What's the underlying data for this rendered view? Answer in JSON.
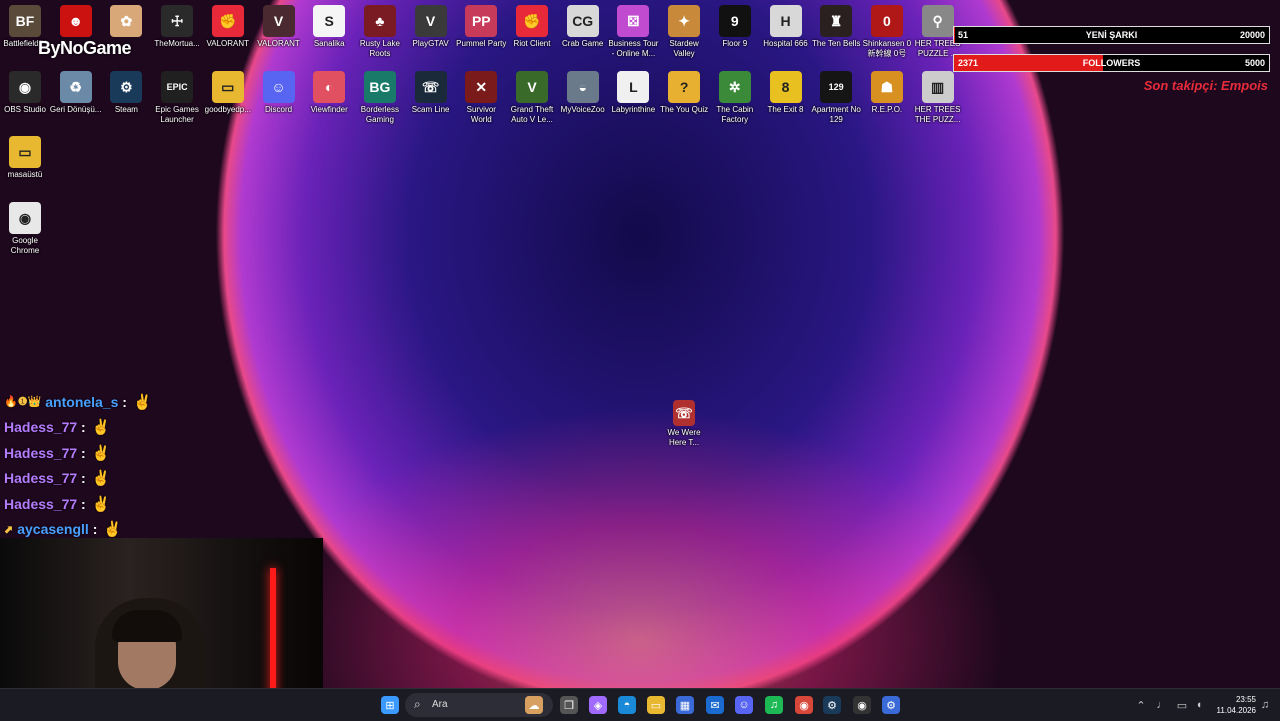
{
  "desktop_icons": [
    {
      "label": "Battlefield™",
      "color": "#5a4a3a",
      "glyph": "BF",
      "col": 0,
      "row": 0
    },
    {
      "label": "",
      "color": "#cc1111",
      "glyph": "☻",
      "col": 1,
      "row": 0
    },
    {
      "label": "",
      "color": "#d9a878",
      "glyph": "✿",
      "col": 2,
      "row": 0
    },
    {
      "label": "TheMortua...",
      "color": "#2a2a2a",
      "glyph": "☩",
      "col": 3,
      "row": 0
    },
    {
      "label": "VALORANT",
      "color": "#e8293a",
      "glyph": "✊",
      "col": 4,
      "row": 0
    },
    {
      "label": "VALORANT",
      "color": "#4a2a30",
      "glyph": "V",
      "col": 5,
      "row": 0
    },
    {
      "label": "Sanalika",
      "color": "#f5f5f5",
      "glyph": "S",
      "col": 6,
      "row": 0
    },
    {
      "label": "Rusty Lake Roots",
      "color": "#7a1a22",
      "glyph": "♣",
      "col": 7,
      "row": 0
    },
    {
      "label": "PlayGTAV",
      "color": "#3a3a3a",
      "glyph": "V",
      "col": 8,
      "row": 0
    },
    {
      "label": "Pummel Party",
      "color": "#c83a5a",
      "glyph": "PP",
      "col": 9,
      "row": 0
    },
    {
      "label": "Riot Client",
      "color": "#e8293a",
      "glyph": "✊",
      "col": 10,
      "row": 0
    },
    {
      "label": "Crab Game",
      "color": "#d8d8d8",
      "glyph": "CG",
      "col": 11,
      "row": 0
    },
    {
      "label": "Business Tour - Online M...",
      "color": "#c04ad0",
      "glyph": "⚄",
      "col": 12,
      "row": 0
    },
    {
      "label": "Stardew Valley",
      "color": "#c88a3a",
      "glyph": "✦",
      "col": 13,
      "row": 0
    },
    {
      "label": "Floor 9",
      "color": "#111111",
      "glyph": "9",
      "col": 14,
      "row": 0
    },
    {
      "label": "Hospital 666",
      "color": "#d8d8d8",
      "glyph": "H",
      "col": 15,
      "row": 0
    },
    {
      "label": "The Ten Bells",
      "color": "#2a2020",
      "glyph": "♜",
      "col": 16,
      "row": 0
    },
    {
      "label": "Shinkansen 0 新幹線 0号",
      "color": "#b01818",
      "glyph": "0",
      "col": 17,
      "row": 0
    },
    {
      "label": "HER TREES PUZZLE ...",
      "color": "#888888",
      "glyph": "⚲",
      "col": 18,
      "row": 0
    },
    {
      "label": "OBS Studio",
      "color": "#2a2a2a",
      "glyph": "◉",
      "col": 0,
      "row": 1
    },
    {
      "label": "Geri Dönüşü...",
      "color": "#6a8aa8",
      "glyph": "♻",
      "col": 1,
      "row": 1
    },
    {
      "label": "Steam",
      "color": "#1a3a5a",
      "glyph": "⚙",
      "col": 2,
      "row": 1
    },
    {
      "label": "Epic Games Launcher",
      "color": "#202020",
      "glyph": "EPIC",
      "col": 3,
      "row": 1
    },
    {
      "label": "goodbyedp...",
      "color": "#e8b830",
      "glyph": "▭",
      "col": 4,
      "row": 1
    },
    {
      "label": "Discord",
      "color": "#5865f2",
      "glyph": "☺",
      "col": 5,
      "row": 1
    },
    {
      "label": "Viewfinder",
      "color": "#e05060",
      "glyph": "◐",
      "col": 6,
      "row": 1
    },
    {
      "label": "Borderless Gaming",
      "color": "#1a7a6a",
      "glyph": "BG",
      "col": 7,
      "row": 1
    },
    {
      "label": "Scam Line",
      "color": "#1a2a3a",
      "glyph": "☏",
      "col": 8,
      "row": 1
    },
    {
      "label": "Survivor World",
      "color": "#7a1a1a",
      "glyph": "✕",
      "col": 9,
      "row": 1
    },
    {
      "label": "Grand Theft Auto V Le...",
      "color": "#3a6a2a",
      "glyph": "V",
      "col": 10,
      "row": 1
    },
    {
      "label": "MyVoiceZoo",
      "color": "#6a7a8a",
      "glyph": "◒",
      "col": 11,
      "row": 1
    },
    {
      "label": "Labyrinthine",
      "color": "#f0f0f0",
      "glyph": "L",
      "col": 12,
      "row": 1
    },
    {
      "label": "The You Quiz",
      "color": "#e8b030",
      "glyph": "?",
      "col": 13,
      "row": 1
    },
    {
      "label": "The Cabin Factory",
      "color": "#3a8a3a",
      "glyph": "✲",
      "col": 14,
      "row": 1
    },
    {
      "label": "The Exit 8",
      "color": "#e8c020",
      "glyph": "8",
      "col": 15,
      "row": 1
    },
    {
      "label": "Apartment No 129",
      "color": "#151515",
      "glyph": "129",
      "col": 16,
      "row": 1
    },
    {
      "label": "R.E.P.O.",
      "color": "#d89020",
      "glyph": "☗",
      "col": 17,
      "row": 1
    },
    {
      "label": "HER TREES THE PUZZ...",
      "color": "#cccccc",
      "glyph": "▥",
      "col": 18,
      "row": 1
    },
    {
      "label": "masaüstü",
      "color": "#e8b830",
      "glyph": "▭",
      "col": 0,
      "row": 2
    },
    {
      "label": "Google Chrome",
      "color": "#e8e8e8",
      "glyph": "◉",
      "col": 0,
      "row": 3
    }
  ],
  "floating_icon": {
    "label": "We Were Here T...",
    "color": "#b03030",
    "glyph": "☏"
  },
  "stream_overlay": {
    "brand": "ByNoGame",
    "song_bar": {
      "left": "51",
      "center": "YENİ ŞARKI",
      "right": "20000",
      "fill": 0.0025
    },
    "follower_bar": {
      "left": "2371",
      "center": "FOLLOWERS",
      "right": "5000",
      "fill": 0.474
    },
    "last_follower": "Son takipçi: Empois"
  },
  "chat": [
    {
      "badges": "🔥❶👑",
      "name": "antonela_s",
      "name_color": "#4aa0ff",
      "msg": "✌"
    },
    {
      "badges": "",
      "name": "Hadess_77",
      "name_color": "#b57cff",
      "msg": "✌"
    },
    {
      "badges": "",
      "name": "Hadess_77",
      "name_color": "#b57cff",
      "msg": "✌"
    },
    {
      "badges": "",
      "name": "Hadess_77",
      "name_color": "#b57cff",
      "msg": "✌"
    },
    {
      "badges": "",
      "name": "Hadess_77",
      "name_color": "#b57cff",
      "msg": "✌"
    },
    {
      "badges": "⬈",
      "name": "aycasengll",
      "name_color": "#4aa0ff",
      "msg": "✌"
    }
  ],
  "taskbar": {
    "search_placeholder": "Ara",
    "apps": [
      {
        "name": "start-button",
        "glyph": "⊞",
        "color": "#3a9aff"
      },
      {
        "name": "widgets-button",
        "glyph": "☁",
        "color": "#d8a060"
      },
      {
        "name": "task-view-button",
        "glyph": "❐",
        "color": "#555"
      },
      {
        "name": "copilot-button",
        "glyph": "◈",
        "color": "#a06aff"
      },
      {
        "name": "edge-button",
        "glyph": "◓",
        "color": "#1a8ad8"
      },
      {
        "name": "file-explorer-button",
        "glyph": "▭",
        "color": "#e8b830"
      },
      {
        "name": "store-button",
        "glyph": "▦",
        "color": "#3a6ad8"
      },
      {
        "name": "outlook-button",
        "glyph": "✉",
        "color": "#1a6ad0"
      },
      {
        "name": "discord-button",
        "glyph": "☺",
        "color": "#5865f2"
      },
      {
        "name": "spotify-button",
        "glyph": "♫",
        "color": "#1db954"
      },
      {
        "name": "chrome-button",
        "glyph": "◉",
        "color": "#d8483a"
      },
      {
        "name": "steam-button",
        "glyph": "⚙",
        "color": "#1a3a5a"
      },
      {
        "name": "obs-button",
        "glyph": "◉",
        "color": "#333"
      },
      {
        "name": "settings-button",
        "glyph": "⚙",
        "color": "#3a6ad8"
      }
    ],
    "clock_time": "23:55",
    "clock_date": "11.04.2026"
  }
}
